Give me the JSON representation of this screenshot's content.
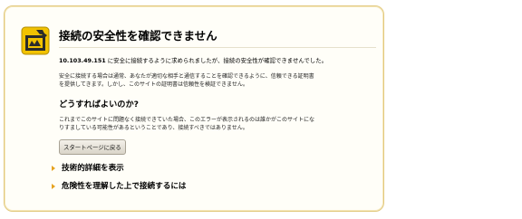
{
  "page": {
    "title": "接続の安全性を確認できません",
    "host_line": {
      "host": "10.103.49.151",
      "suffix": " に安全に接続するように求められましたが、接続の安全性が確認できませんでした。"
    },
    "para1_line1": "安全に接続する場合は通常、あなたが適切な相手と通信することを確認できるように、信頼できる証明書",
    "para1_line2": "を提供してきます。しかし、このサイトの証明書は信頼性を検証できません。",
    "subheading": "どうすればよいのか?",
    "para2_line1": "これまでこのサイトに問題なく接続できていた場合、このエラーが表示されるのは誰かがこのサイトにな",
    "para2_line2": "りすましている可能性があるということであり、接続すべきではありません。",
    "back_button": "スタートページに戻る",
    "technical_details": "技術的詳細を表示",
    "understand_risks": "危険性を理解した上で接続するには"
  },
  "colors": {
    "accent": "#e6a320",
    "badge_bg": "#f2c200",
    "panel_border": "#e2c97e"
  },
  "icons": [
    "cursor-icon",
    "security-warning-icon",
    "expand-triangle-icon"
  ]
}
